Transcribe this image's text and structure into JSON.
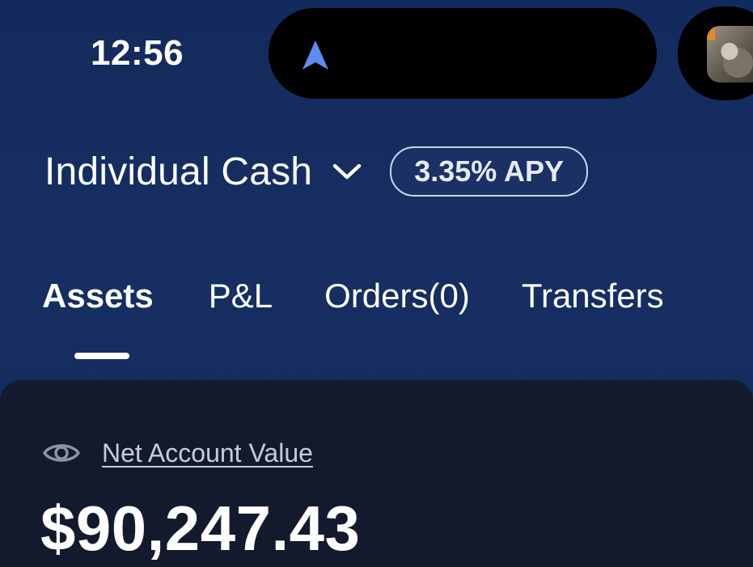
{
  "status_bar": {
    "time": "12:56",
    "nav_icon": "navigation-arrow-icon",
    "live_activity_icon": "camera-thumbnail"
  },
  "account": {
    "name": "Individual Cash",
    "chevron_icon": "chevron-down-icon",
    "apy_badge": "3.35% APY"
  },
  "tabs": [
    {
      "label": "Assets",
      "active": true
    },
    {
      "label": "P&L",
      "active": false
    },
    {
      "label": "Orders(0)",
      "active": false
    },
    {
      "label": "Transfers",
      "active": false
    }
  ],
  "summary": {
    "visibility_icon": "eye-icon",
    "label": "Net Account Value",
    "value": "$90,247.43"
  },
  "colors": {
    "background": "#132a5c",
    "panel": "#141a2d",
    "accent_blue": "#5b8ef0",
    "text": "#ffffff"
  }
}
